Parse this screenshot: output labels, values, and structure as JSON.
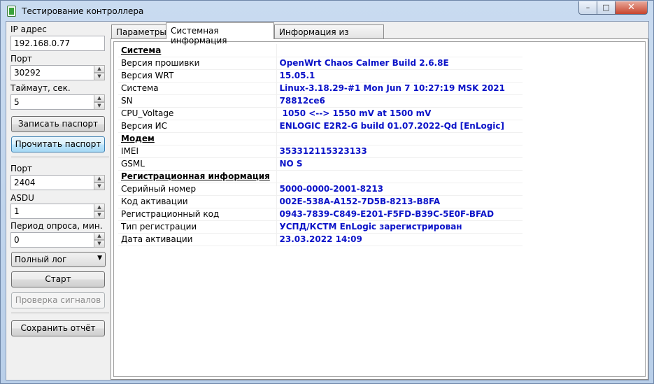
{
  "window": {
    "title": "Тестирование контроллера",
    "min_glyph": "–",
    "max_glyph": "□",
    "close_glyph": "✕"
  },
  "left": {
    "ip_label": "IP адрес",
    "ip_value": "192.168.0.77",
    "port_label": "Порт",
    "port_value": "30292",
    "timeout_label": "Таймаут, сек.",
    "timeout_value": "5",
    "write_passport": "Записать паспорт",
    "read_passport": "Прочитать паспорт",
    "port2_label": "Порт",
    "port2_value": "2404",
    "asdu_label": "ASDU",
    "asdu_value": "1",
    "period_label": "Период опроса, мин.",
    "period_value": "0",
    "log_select": "Полный лог",
    "start": "Старт",
    "check_signals": "Проверка сигналов",
    "save_report": "Сохранить отчёт"
  },
  "tabs": [
    "Параметры",
    "Системная информация",
    "Информация из паспорта"
  ],
  "info": {
    "sec_system": "Система",
    "firmware_k": "Версия прошивки",
    "firmware_v": "OpenWrt Chaos Calmer Build 2.6.8E",
    "wrt_k": "Версия WRT",
    "wrt_v": "15.05.1",
    "system_k": "Система",
    "system_v": "Linux-3.18.29-#1 Mon Jun 7 10:27:19 MSK 2021",
    "sn_k": "SN",
    "sn_v": "78812ce6",
    "cpu_k": "CPU_Voltage",
    "cpu_v": " 1050 <--> 1550 mV at 1500 mV",
    "is_k": "Версия ИС",
    "is_v": "ENLOGIC E2R2-G build 01.07.2022-Qd [EnLogic]",
    "sec_modem": "Модем",
    "imei_k": "IMEI",
    "imei_v": "353312115323133",
    "gsml_k": "GSML",
    "gsml_v": "NO S",
    "sec_reg": "Регистрационная информация",
    "serial_k": "Серийный номер",
    "serial_v": "5000-0000-2001-8213",
    "activation_k": "Код активации",
    "activation_v": "002E-538A-A152-7D5B-8213-B8FA",
    "regcode_k": "Регистрационный код",
    "regcode_v": "0943-7839-C849-E201-F5FD-B39C-5E0F-BFAD",
    "regtype_k": "Тип регистрации",
    "regtype_v": "УСПД/КСТМ EnLogic зарегистрирован",
    "actdate_k": "Дата активации",
    "actdate_v": "23.03.2022 14:09"
  }
}
